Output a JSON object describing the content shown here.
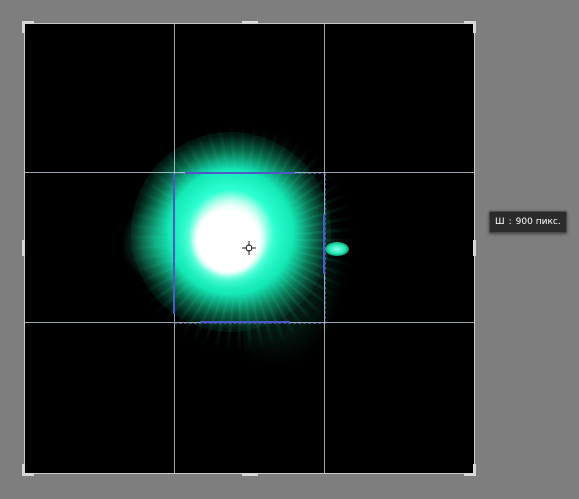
{
  "canvas": {
    "background_color": "#7e7e7e",
    "document_color": "#000000",
    "glow_color": "#2dffd2",
    "core_color": "#ffffff",
    "guide_color": "#c8dce6",
    "selection_color": "#4f58c8"
  },
  "tool": {
    "name": "crop",
    "overlay": "rule-of-thirds"
  },
  "tooltip": {
    "label": "Ш",
    "separator": ":",
    "value": "900 пикс."
  },
  "icons": {
    "crosshair": "transform-reference-point-icon"
  }
}
